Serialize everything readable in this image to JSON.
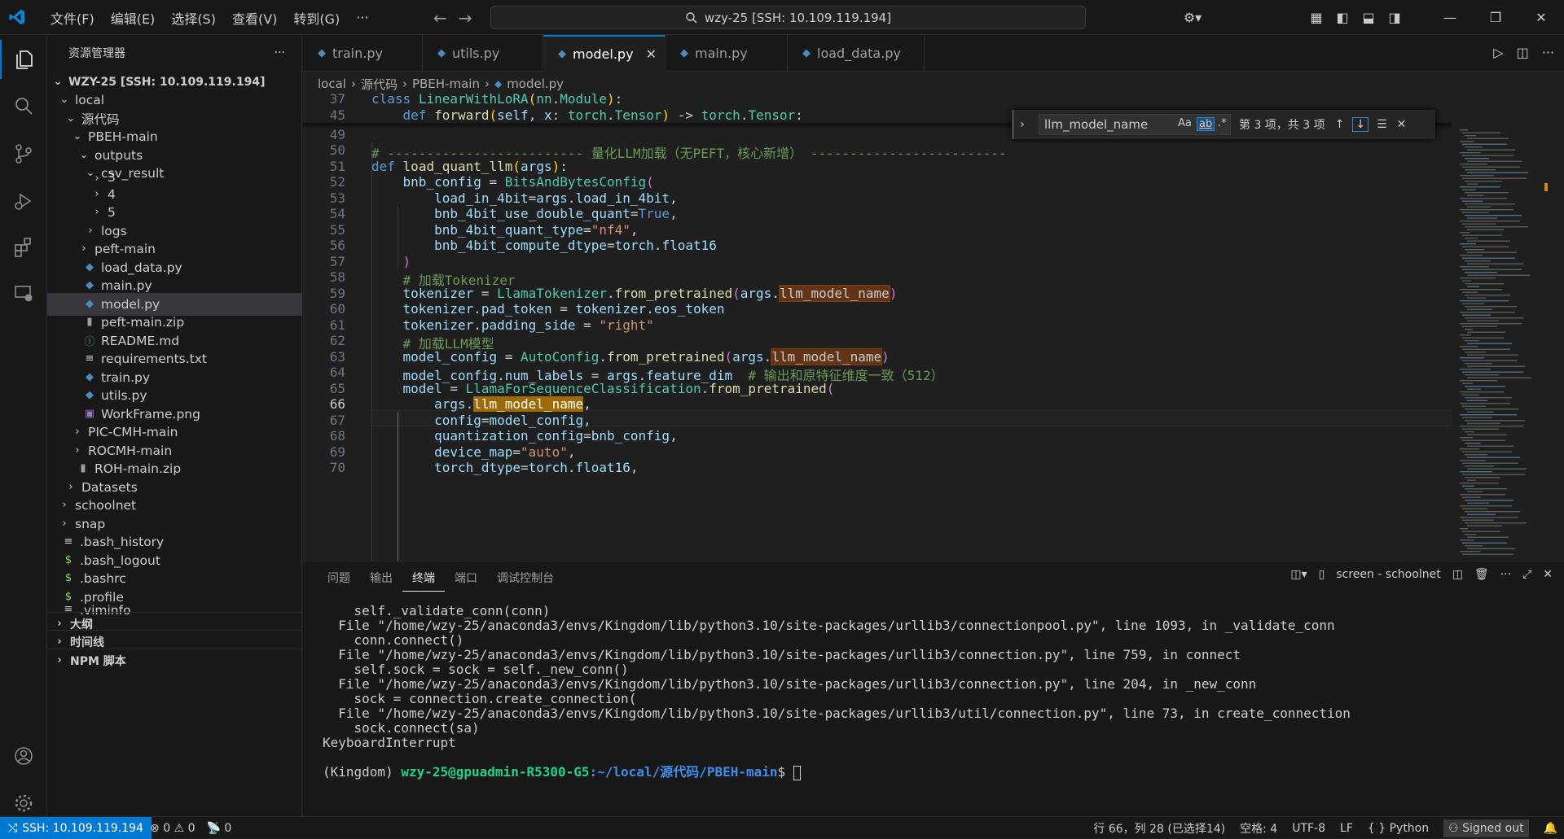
{
  "titlebar": {
    "menu": [
      "文件(F)",
      "编辑(E)",
      "选择(S)",
      "查看(V)",
      "转到(G)",
      "···"
    ],
    "command_center": "wzy-25 [SSH: 10.109.119.194]"
  },
  "sidebar": {
    "title": "资源管理器",
    "more": "···",
    "root": "WZY-25 [SSH: 10.109.119.194]",
    "items": [
      {
        "label": "local"
      },
      {
        "label": "源代码"
      },
      {
        "label": "PBEH-main"
      },
      {
        "label": "outputs"
      },
      {
        "label": "csv_result"
      },
      {
        "label": "3"
      },
      {
        "label": "4"
      },
      {
        "label": "5"
      },
      {
        "label": "logs"
      },
      {
        "label": "peft-main"
      },
      {
        "label": "load_data.py"
      },
      {
        "label": "main.py"
      },
      {
        "label": "model.py"
      },
      {
        "label": "peft-main.zip"
      },
      {
        "label": "README.md"
      },
      {
        "label": "requirements.txt"
      },
      {
        "label": "train.py"
      },
      {
        "label": "utils.py"
      },
      {
        "label": "WorkFrame.png"
      },
      {
        "label": "PIC-CMH-main"
      },
      {
        "label": "ROCMH-main"
      },
      {
        "label": "ROH-main.zip"
      },
      {
        "label": "Datasets"
      },
      {
        "label": "schoolnet"
      },
      {
        "label": "snap"
      },
      {
        "label": ".bash_history"
      },
      {
        "label": ".bash_logout"
      },
      {
        "label": ".bashrc"
      },
      {
        "label": ".profile"
      },
      {
        "label": ".viminfo"
      }
    ],
    "sections": [
      "大纲",
      "时间线",
      "NPM 脚本"
    ]
  },
  "editor": {
    "tabs": [
      {
        "label": "train.py"
      },
      {
        "label": "utils.py"
      },
      {
        "label": "model.py",
        "close": "✕"
      },
      {
        "label": "main.py"
      },
      {
        "label": "load_data.py"
      }
    ],
    "breadcrumb": [
      "local",
      "源代码",
      "PBEH-main",
      "model.py"
    ],
    "line_numbers": [
      "37",
      "45",
      "49",
      "50",
      "51",
      "52",
      "53",
      "54",
      "55",
      "56",
      "57",
      "58",
      "59",
      "60",
      "61",
      "62",
      "63",
      "64",
      "65",
      "66",
      "67",
      "68",
      "69",
      "70"
    ],
    "find": {
      "query": "llm_model_name",
      "match_case": "Aa",
      "whole_word": "ab",
      "regex": ".*",
      "result": "第 3 项，共 3 项"
    }
  },
  "panel": {
    "tabs": [
      "问题",
      "输出",
      "终端",
      "端口",
      "调试控制台"
    ],
    "terminal_name": "screen - schoolnet",
    "lines": [
      "    self._validate_conn(conn)",
      "  File \"/home/wzy-25/anaconda3/envs/Kingdom/lib/python3.10/site-packages/urllib3/connectionpool.py\", line 1093, in _validate_conn",
      "    conn.connect()",
      "  File \"/home/wzy-25/anaconda3/envs/Kingdom/lib/python3.10/site-packages/urllib3/connection.py\", line 759, in connect",
      "    self.sock = sock = self._new_conn()",
      "  File \"/home/wzy-25/anaconda3/envs/Kingdom/lib/python3.10/site-packages/urllib3/connection.py\", line 204, in _new_conn",
      "    sock = connection.create_connection(",
      "  File \"/home/wzy-25/anaconda3/envs/Kingdom/lib/python3.10/site-packages/urllib3/util/connection.py\", line 73, in create_connection",
      "    sock.connect(sa)",
      "KeyboardInterrupt",
      ""
    ],
    "prompt_env": "(Kingdom) ",
    "prompt_user": "wzy-25@gpuadmin-R5300-G5",
    "prompt_path": ":~/local/源代码/PBEH-main",
    "prompt_end": "$ "
  },
  "statusbar": {
    "remote": "SSH: 10.109.119.194",
    "errors": "0",
    "warnings": "0",
    "ports": "0",
    "position": "行 66，列 28 (已选择14)",
    "spaces": "空格: 4",
    "encoding": "UTF-8",
    "eol": "LF",
    "language": "Python",
    "account": "Signed out"
  },
  "colors": {
    "accent": "#0078d4",
    "find_match": "#623315",
    "current_match": "#9e6a03"
  }
}
